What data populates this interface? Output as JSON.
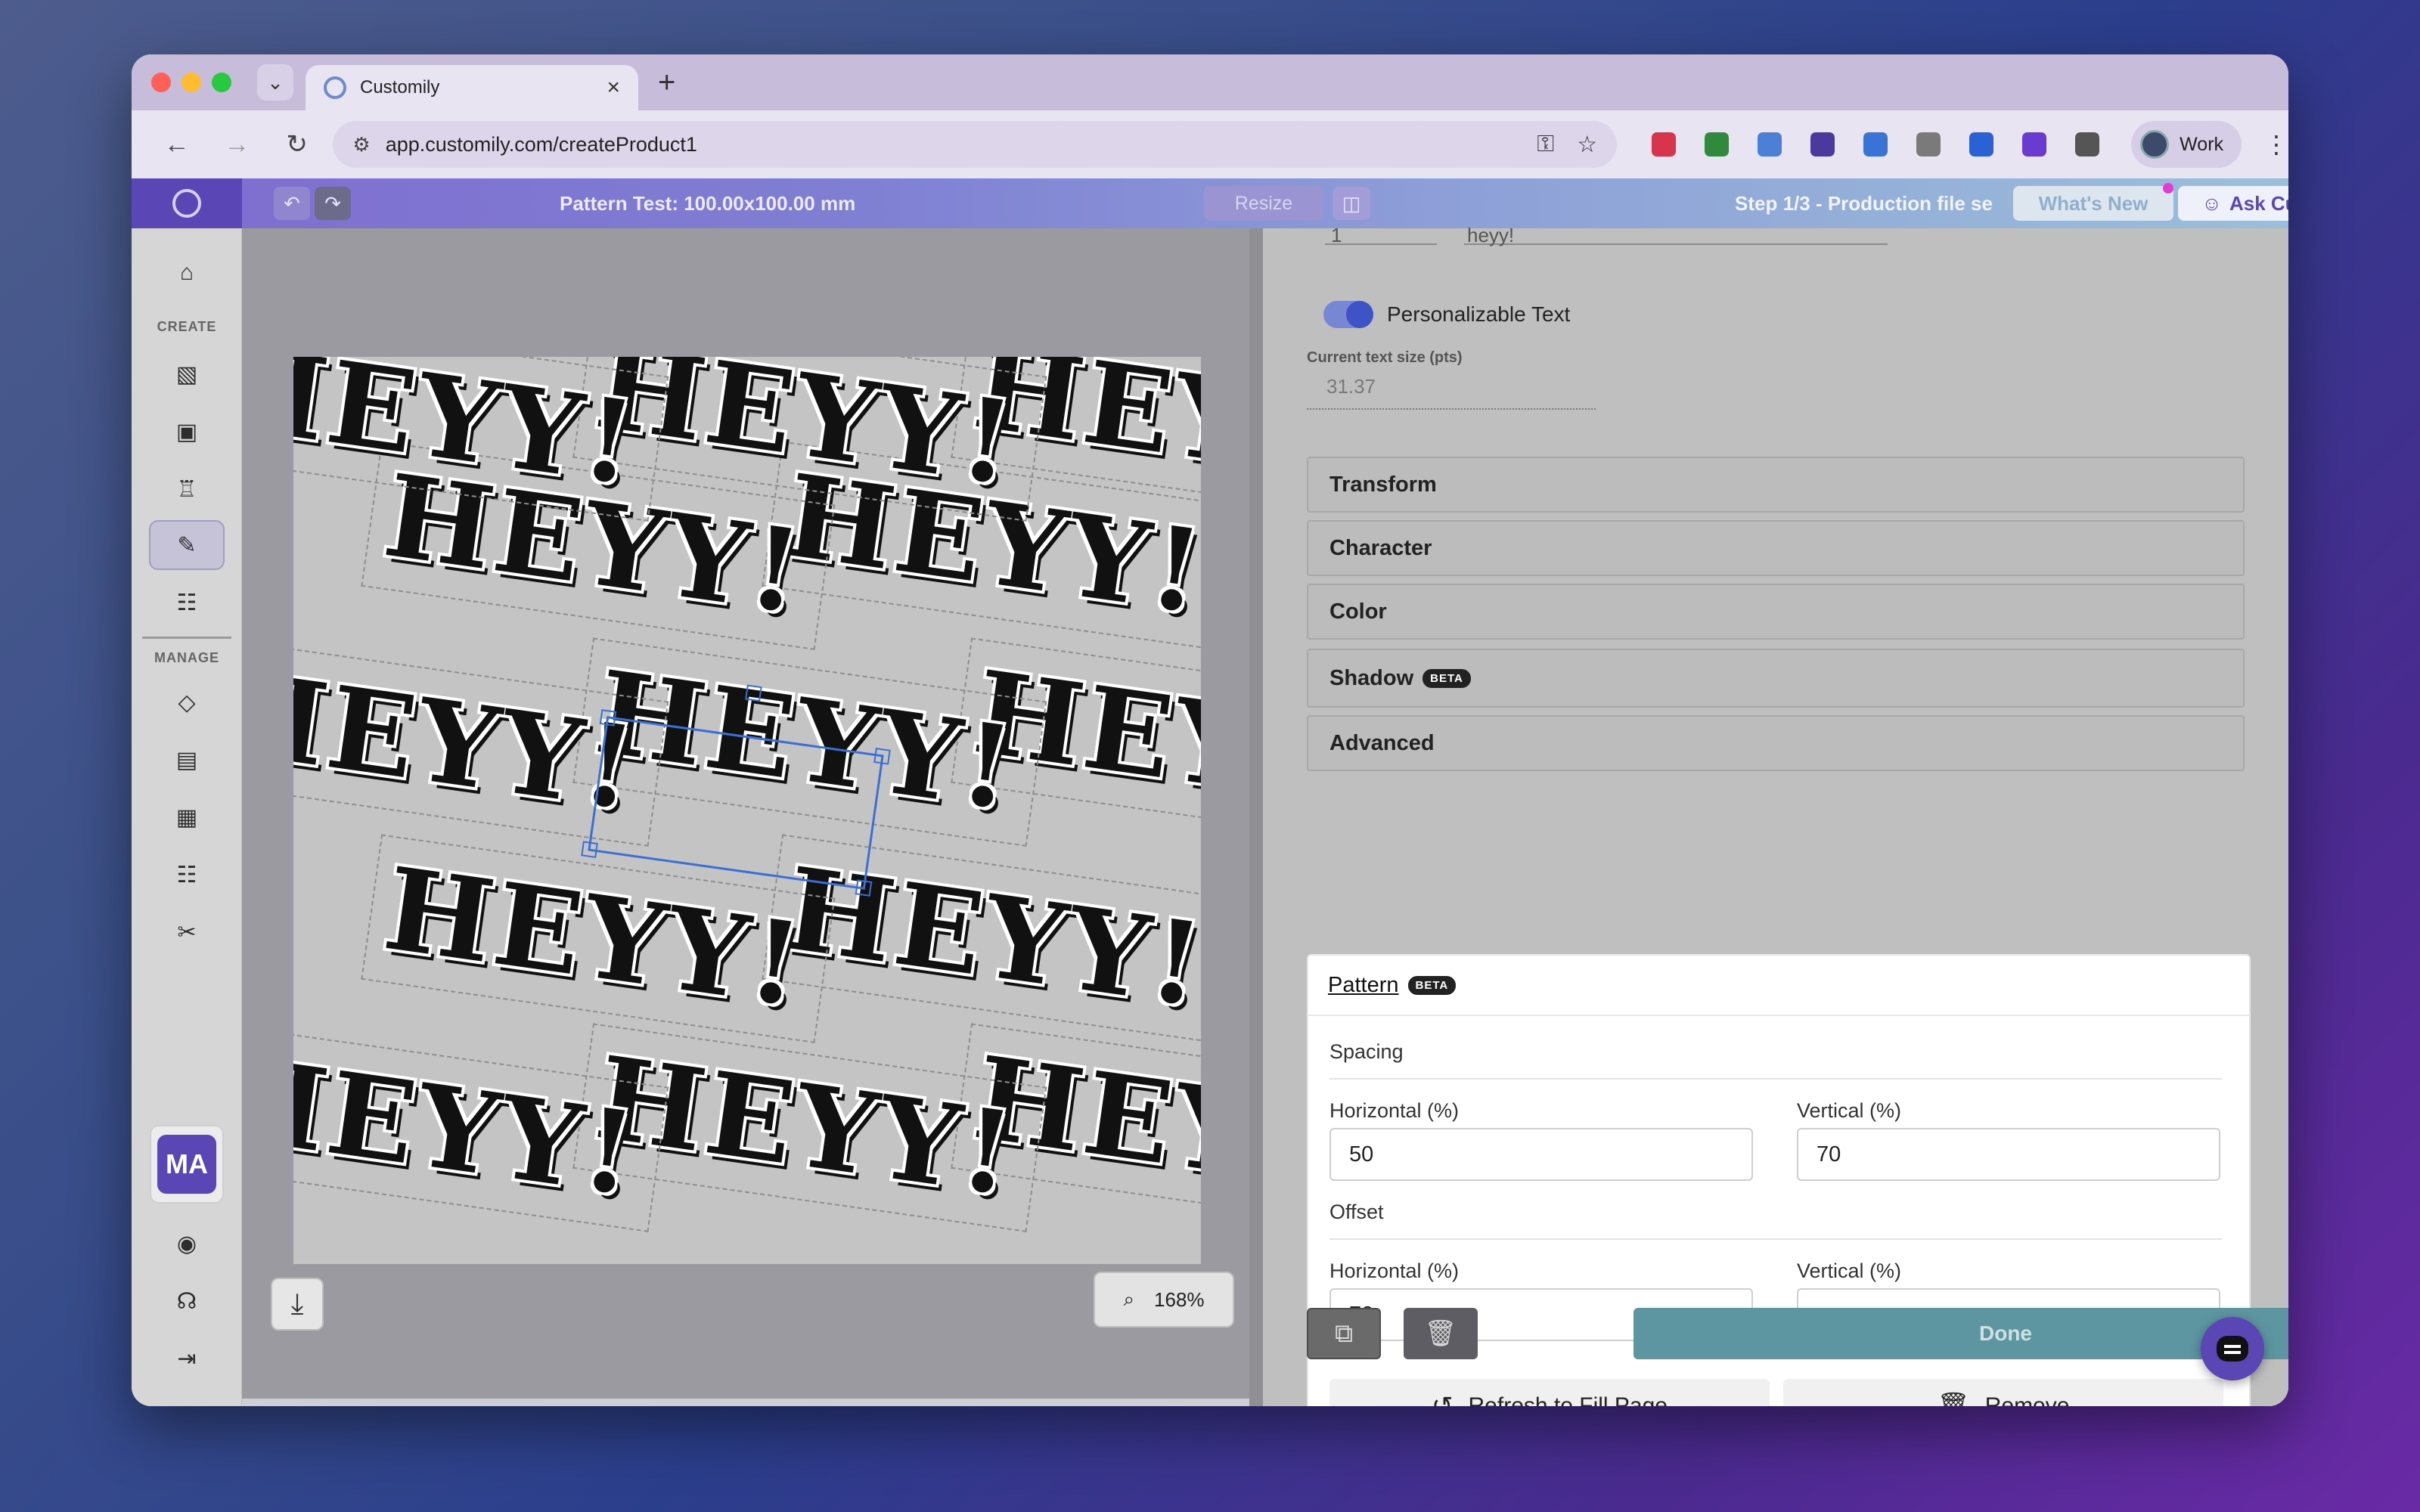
{
  "browser": {
    "tab_title": "Customily",
    "tab_close": "×",
    "new_tab": "+",
    "tab_menu": "⌄",
    "url": "app.customily.com/createProduct1",
    "profile_label": "Work",
    "nav": {
      "back": "←",
      "forward": "→",
      "reload": "↻"
    },
    "omni_icons": {
      "tune": "⚙",
      "key": "⚿",
      "star": "☆"
    },
    "kebab": "⋮",
    "extensions": [
      {
        "icon": "ext-red-icon",
        "color": "#d8344d"
      },
      {
        "icon": "ext-multicolor-icon",
        "color": "#2f8a3e"
      },
      {
        "icon": "ext-customily-icon",
        "color": "#4c7fd6"
      },
      {
        "icon": "ext-purple-icon",
        "color": "#4b3a9e"
      },
      {
        "icon": "ext-doc-icon",
        "color": "#3a73d6"
      },
      {
        "icon": "ext-camera-icon",
        "color": "#7a7a7a"
      },
      {
        "icon": "ext-blue-square-icon",
        "color": "#2a62d6"
      },
      {
        "icon": "ext-v-icon",
        "color": "#6a3bd1"
      },
      {
        "icon": "ext-puzzle-icon",
        "color": "#555555"
      }
    ]
  },
  "sidebar": {
    "create_label": "CREATE",
    "manage_label": "MANAGE",
    "avatar_initials": "MA",
    "icons": {
      "home": "⌂",
      "create1": "▧",
      "create2": "▣",
      "create3": "♖",
      "create4": "✎",
      "create5": "☷",
      "manage1": "◇",
      "manage2": "▤",
      "manage3": "▦",
      "manage4": "☷",
      "manage5": "✂",
      "account": "◉",
      "support": "☊",
      "logout": "⇥"
    }
  },
  "header": {
    "undo": "↶",
    "redo": "↷",
    "title": "Pattern Test: 100.00x100.00 mm",
    "resize_label": "Resize",
    "resize_icon": "◫",
    "step_label": "Step 1/3 - Production file se",
    "whats_new_label": "What's New",
    "ask_label": "Ask Customily"
  },
  "canvas": {
    "pattern_text": "HEYY!",
    "zoom_label": "168%",
    "zoom_icon": "⌕",
    "download_icon": "⤓"
  },
  "panel": {
    "top_field_left": "1",
    "top_field_right": "heyy!",
    "personalizable_label": "Personalizable Text",
    "text_size_label": "Current text size (pts)",
    "text_size_value": "31.37",
    "sections": [
      "Transform",
      "Character",
      "Color",
      "Shadow",
      "Advanced"
    ],
    "beta_badge": "BETA",
    "pattern": {
      "title": "Pattern",
      "spacing_label": "Spacing",
      "offset_label": "Offset",
      "horizontal_label": "Horizontal (%)",
      "vertical_label": "Vertical (%)",
      "spacing_horizontal": "50",
      "spacing_vertical": "70",
      "offset_horizontal": "70",
      "offset_vertical": "",
      "refresh_label": "Refresh to Fill Page",
      "refresh_icon": "↺",
      "remove_label": "Remove",
      "remove_icon": "🗑"
    },
    "duplicate_icon": "⧉",
    "trash_icon": "🗑",
    "done_label": "Done"
  },
  "colors": {
    "brand_purple": "#5b46b5",
    "done_teal": "#5d95a1",
    "toggle_blue": "#3d53c6"
  }
}
